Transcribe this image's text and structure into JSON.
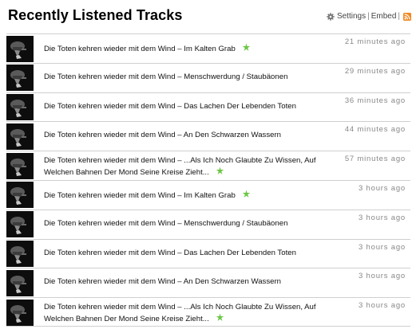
{
  "header": {
    "title": "Recently Listened Tracks",
    "settings_label": "Settings",
    "separator": "|",
    "embed_label": "Embed"
  },
  "icons": {
    "settings": "gear-icon",
    "rss": "rss-icon",
    "loved": "star-icon",
    "album_art": "album-art"
  },
  "colors": {
    "loved_star": "#6cc644",
    "rss": "#f08a24",
    "time": "#888888"
  },
  "tracks": [
    {
      "artist": "Die Toten kehren wieder mit dem Wind",
      "dash": " – ",
      "song": "Im Kalten Grab",
      "loved": true,
      "time": "21 minutes ago"
    },
    {
      "artist": "Die Toten kehren wieder mit dem Wind",
      "dash": " – ",
      "song": "Menschwerdung / Staubäonen",
      "loved": false,
      "time": "29 minutes ago"
    },
    {
      "artist": "Die Toten kehren wieder mit dem Wind",
      "dash": " – ",
      "song": "Das Lachen Der Lebenden Toten",
      "loved": false,
      "time": "36 minutes ago"
    },
    {
      "artist": "Die Toten kehren wieder mit dem Wind",
      "dash": " – ",
      "song": "An Den Schwarzen Wassern",
      "loved": false,
      "time": "44 minutes ago"
    },
    {
      "artist": "Die Toten kehren wieder mit dem Wind",
      "dash": " – ",
      "song": "...Als Ich Noch Glaubte Zu Wissen, Auf Welchen Bahnen Der Mond Seine Kreise Zieht...",
      "loved": true,
      "time": "57 minutes ago"
    },
    {
      "artist": "Die Toten kehren wieder mit dem Wind",
      "dash": " – ",
      "song": "Im Kalten Grab",
      "loved": true,
      "time": "3 hours ago"
    },
    {
      "artist": "Die Toten kehren wieder mit dem Wind",
      "dash": " – ",
      "song": "Menschwerdung / Staubäonen",
      "loved": false,
      "time": "3 hours ago"
    },
    {
      "artist": "Die Toten kehren wieder mit dem Wind",
      "dash": " – ",
      "song": "Das Lachen Der Lebenden Toten",
      "loved": false,
      "time": "3 hours ago"
    },
    {
      "artist": "Die Toten kehren wieder mit dem Wind",
      "dash": " – ",
      "song": "An Den Schwarzen Wassern",
      "loved": false,
      "time": "3 hours ago"
    },
    {
      "artist": "Die Toten kehren wieder mit dem Wind",
      "dash": " – ",
      "song": "...Als Ich Noch Glaubte Zu Wissen, Auf Welchen Bahnen Der Mond Seine Kreise Zieht...",
      "loved": true,
      "time": "3 hours ago"
    }
  ]
}
